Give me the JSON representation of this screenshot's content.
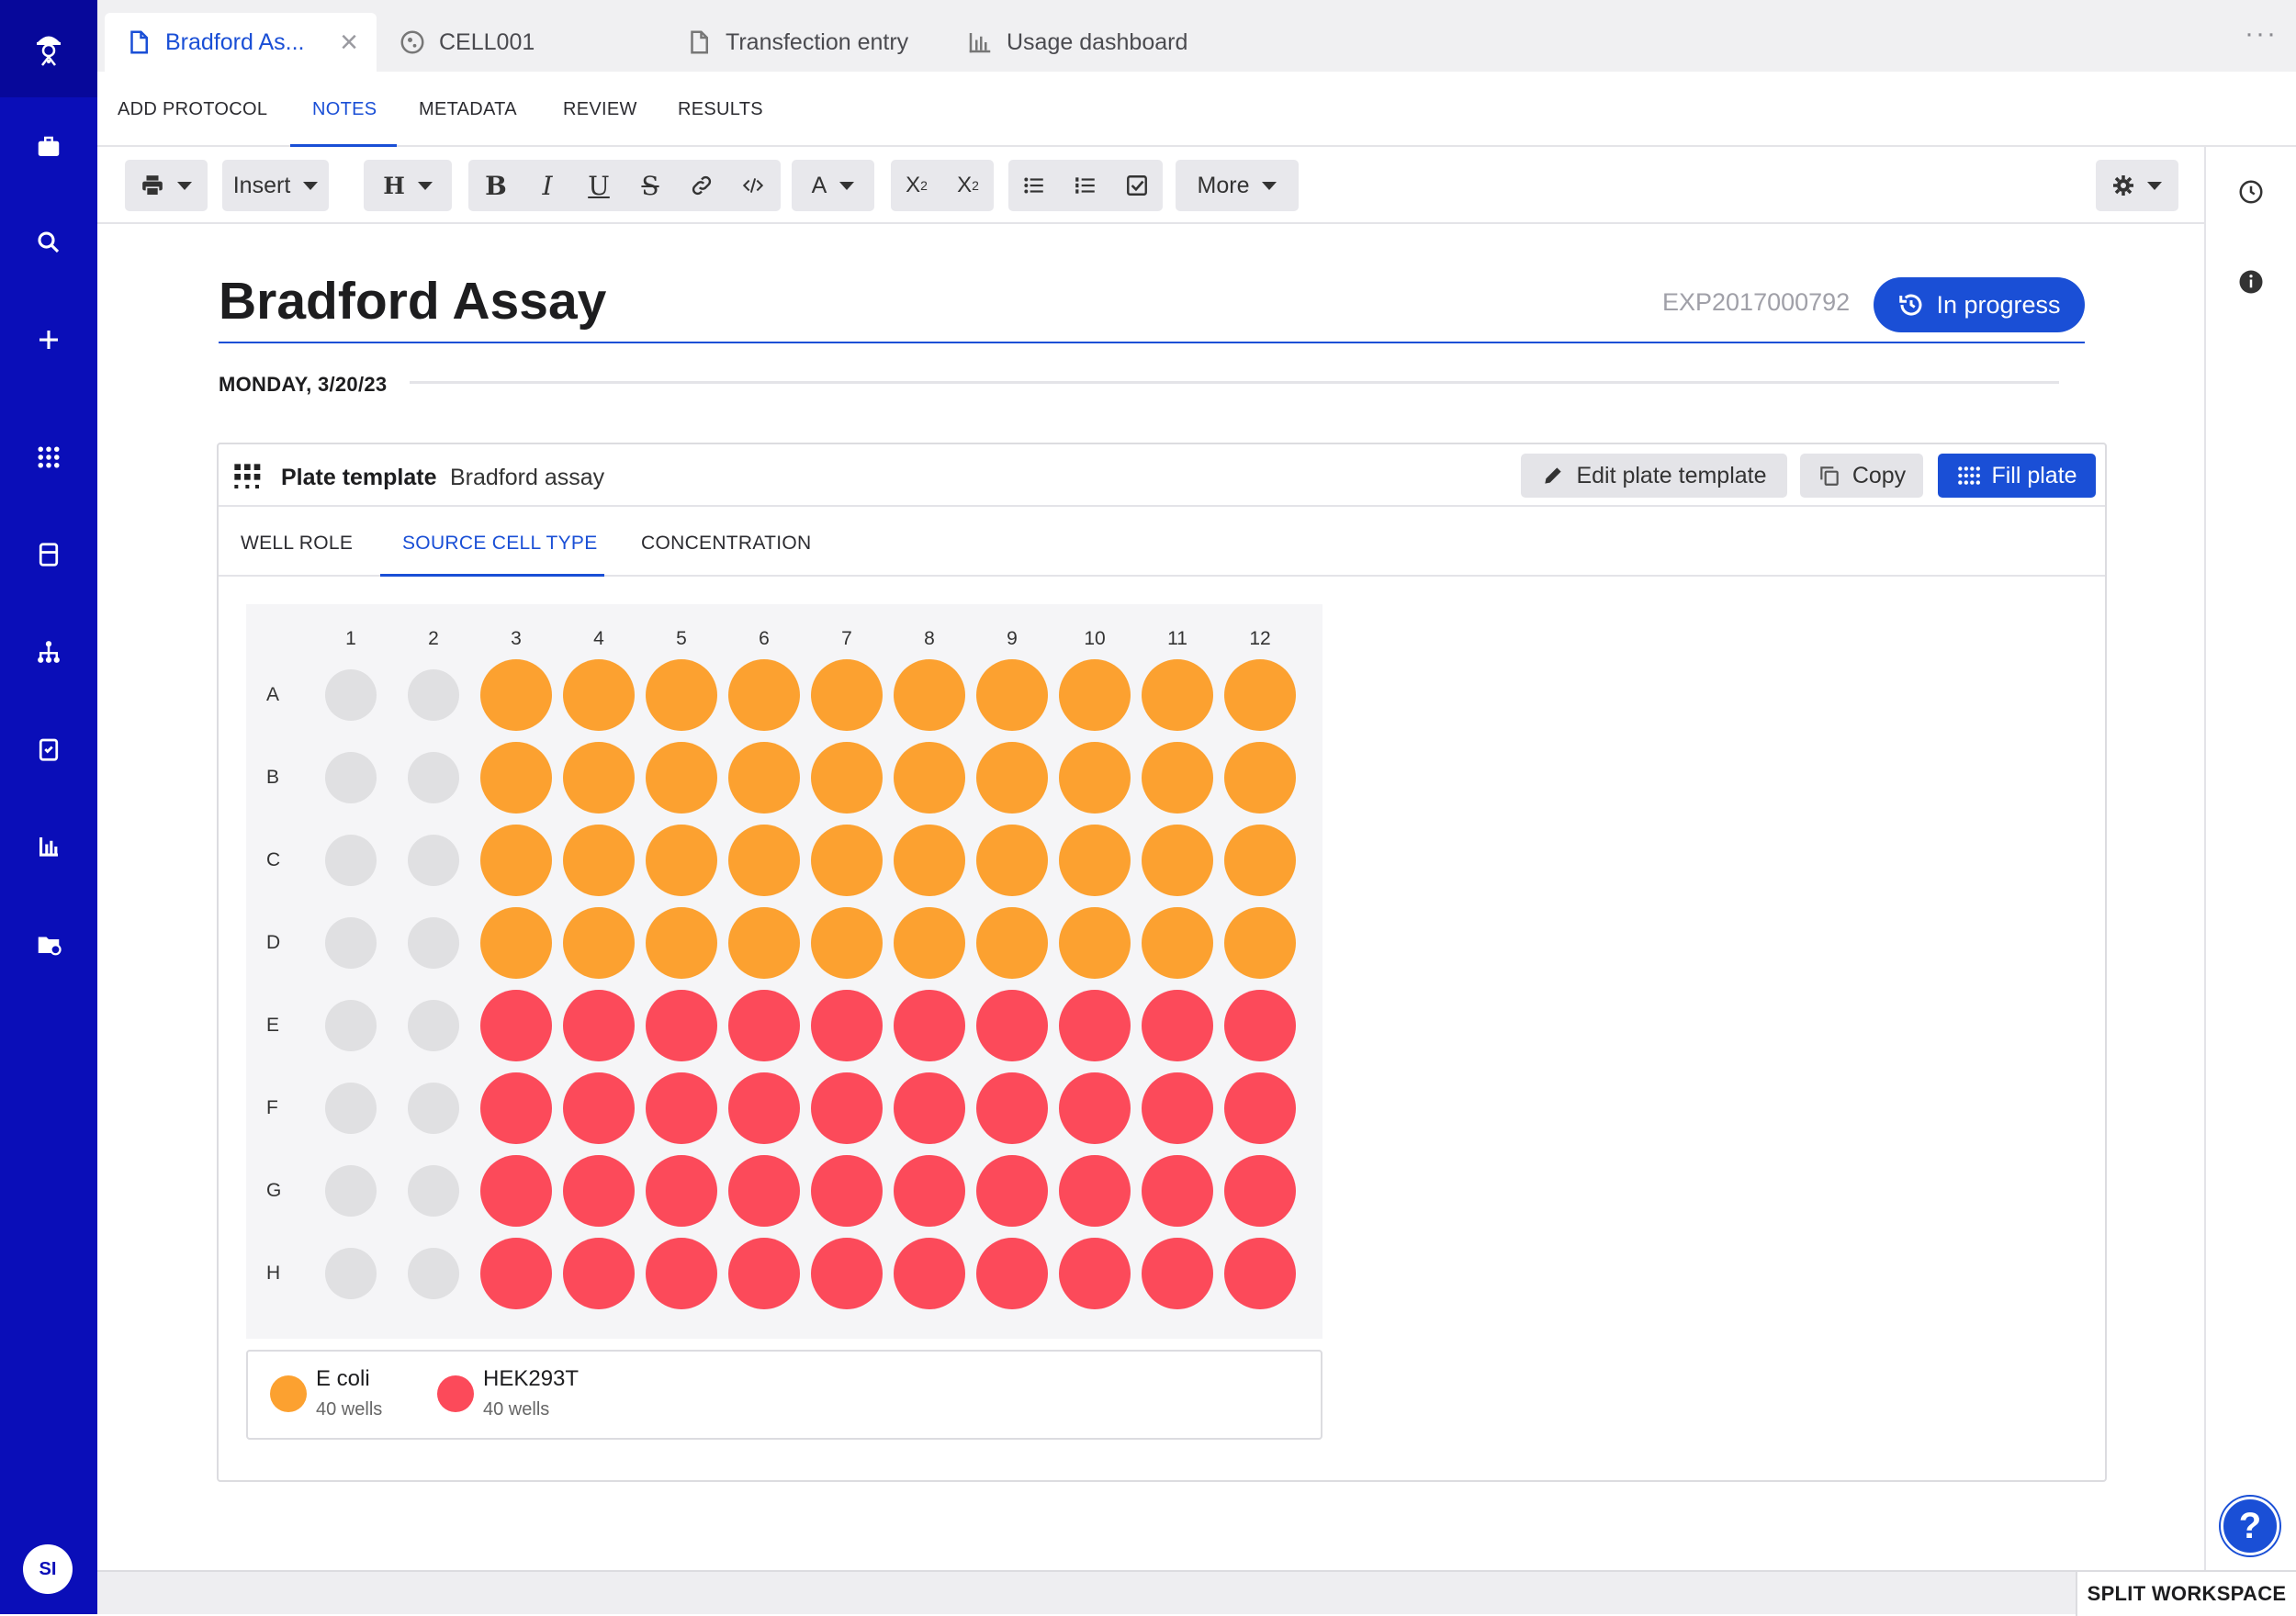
{
  "tabs": [
    {
      "label": "Bradford As...",
      "icon": "document-icon",
      "active": true
    },
    {
      "label": "CELL001",
      "icon": "cell-icon"
    },
    {
      "label": "Transfection entry",
      "icon": "document-icon"
    },
    {
      "label": "Usage dashboard",
      "icon": "chart-icon"
    }
  ],
  "subnav": [
    "ADD PROTOCOL",
    "NOTES",
    "METADATA",
    "REVIEW",
    "RESULTS"
  ],
  "toolbar": {
    "insert_label": "Insert",
    "heading_label": "H",
    "bold": "B",
    "italic": "I",
    "underline": "U",
    "strike": "S",
    "font_color": "A",
    "more_label": "More"
  },
  "entry": {
    "title": "Bradford Assay",
    "id": "EXP2017000792",
    "status": "In progress",
    "date": "MONDAY, 3/20/23"
  },
  "plate_panel": {
    "label": "Plate template",
    "name": "Bradford assay",
    "edit_label": "Edit plate template",
    "copy_label": "Copy",
    "fill_label": "Fill plate",
    "tabs": [
      "WELL ROLE",
      "SOURCE CELL TYPE",
      "CONCENTRATION"
    ],
    "active_tab": "SOURCE CELL TYPE",
    "columns": [
      "1",
      "2",
      "3",
      "4",
      "5",
      "6",
      "7",
      "8",
      "9",
      "10",
      "11",
      "12"
    ],
    "rows": [
      "A",
      "B",
      "C",
      "D",
      "E",
      "F",
      "G",
      "H"
    ],
    "wells": [
      [
        "empty",
        "empty",
        "ecoli",
        "ecoli",
        "ecoli",
        "ecoli",
        "ecoli",
        "ecoli",
        "ecoli",
        "ecoli",
        "ecoli",
        "ecoli"
      ],
      [
        "empty",
        "empty",
        "ecoli",
        "ecoli",
        "ecoli",
        "ecoli",
        "ecoli",
        "ecoli",
        "ecoli",
        "ecoli",
        "ecoli",
        "ecoli"
      ],
      [
        "empty",
        "empty",
        "ecoli",
        "ecoli",
        "ecoli",
        "ecoli",
        "ecoli",
        "ecoli",
        "ecoli",
        "ecoli",
        "ecoli",
        "ecoli"
      ],
      [
        "empty",
        "empty",
        "ecoli",
        "ecoli",
        "ecoli",
        "ecoli",
        "ecoli",
        "ecoli",
        "ecoli",
        "ecoli",
        "ecoli",
        "ecoli"
      ],
      [
        "empty",
        "empty",
        "hek",
        "hek",
        "hek",
        "hek",
        "hek",
        "hek",
        "hek",
        "hek",
        "hek",
        "hek"
      ],
      [
        "empty",
        "empty",
        "hek",
        "hek",
        "hek",
        "hek",
        "hek",
        "hek",
        "hek",
        "hek",
        "hek",
        "hek"
      ],
      [
        "empty",
        "empty",
        "hek",
        "hek",
        "hek",
        "hek",
        "hek",
        "hek",
        "hek",
        "hek",
        "hek",
        "hek"
      ],
      [
        "empty",
        "empty",
        "hek",
        "hek",
        "hek",
        "hek",
        "hek",
        "hek",
        "hek",
        "hek",
        "hek",
        "hek"
      ]
    ],
    "colors": {
      "ecoli": "#fca130",
      "hek": "#fc4a5a",
      "empty": "#e0e0e2"
    },
    "legend": [
      {
        "key": "ecoli",
        "name": "E coli",
        "count": "40 wells"
      },
      {
        "key": "hek",
        "name": "HEK293T",
        "count": "40 wells"
      }
    ]
  },
  "user": {
    "initials": "SI"
  },
  "footer": {
    "split_label": "SPLIT WORKSPACE"
  },
  "help_label": "?"
}
